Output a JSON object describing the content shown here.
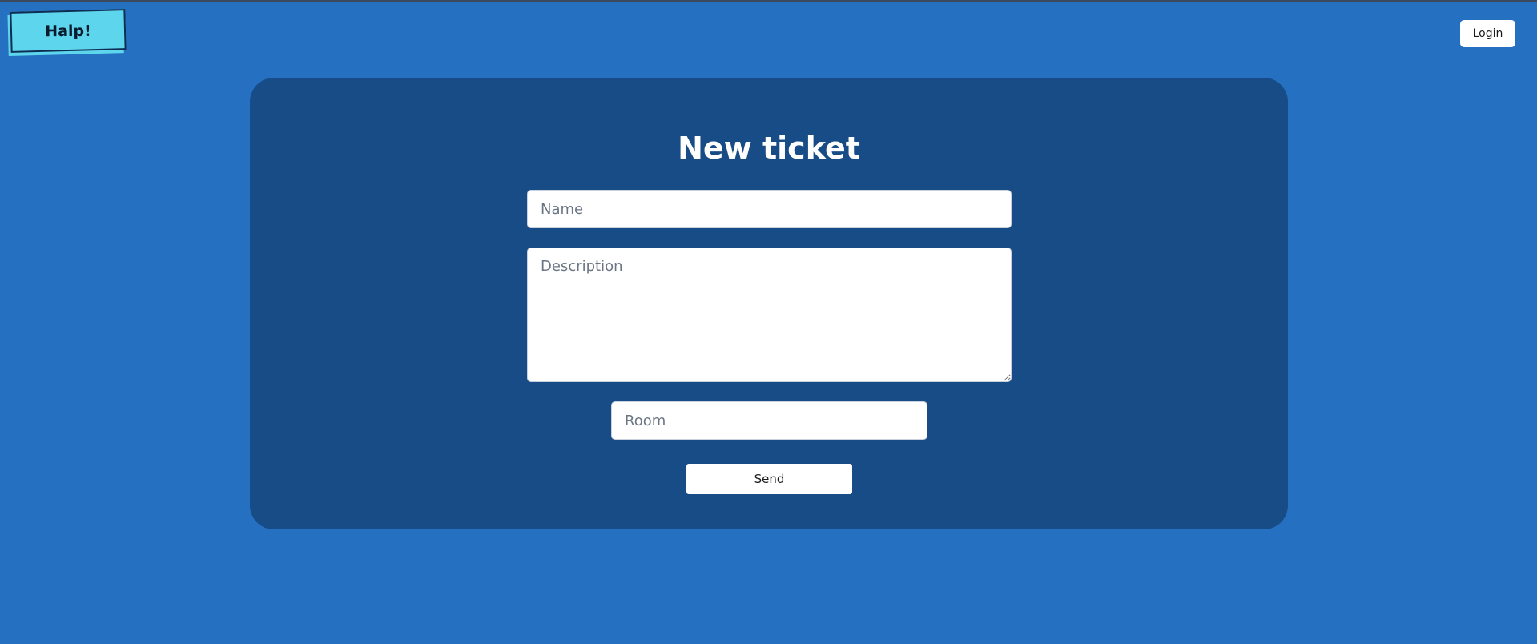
{
  "header": {
    "logo_text": "Halp!",
    "login_label": "Login"
  },
  "form": {
    "title": "New ticket",
    "name_placeholder": "Name",
    "description_placeholder": "Description",
    "room_placeholder": "Room",
    "send_label": "Send"
  },
  "colors": {
    "page_background": "#2670c2",
    "panel_background": "#174c86",
    "logo_background": "#5dd5ec",
    "button_background": "#ffffff"
  }
}
